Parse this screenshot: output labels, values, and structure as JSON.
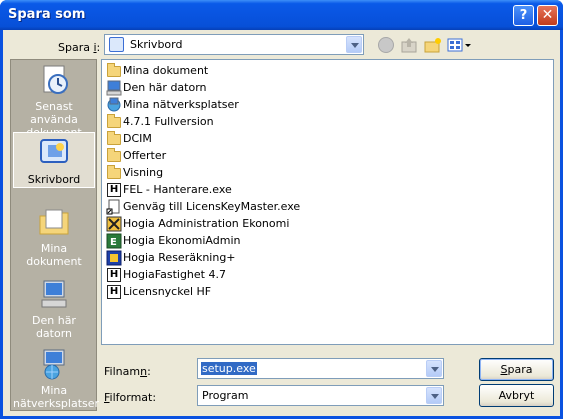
{
  "window": {
    "title": "Spara som"
  },
  "location": {
    "label_prefix": "Spara ",
    "label_key": "i",
    "label_suffix": ":",
    "value": "Skrivbord"
  },
  "places": [
    {
      "label": "Senast använda dokument",
      "icon": "recent-documents-icon"
    },
    {
      "label": "Skrivbord",
      "icon": "desktop-icon"
    },
    {
      "label": "Mina dokument",
      "icon": "my-documents-icon"
    },
    {
      "label": "Den här datorn",
      "icon": "my-computer-icon"
    },
    {
      "label": "Mina nätverksplatser",
      "icon": "network-places-icon"
    }
  ],
  "files": [
    {
      "name": "Mina dokument",
      "icon": "folder-documents-icon"
    },
    {
      "name": "Den här datorn",
      "icon": "computer-icon"
    },
    {
      "name": "Mina nätverksplatser",
      "icon": "network-icon"
    },
    {
      "name": "4.7.1 Fullversion",
      "icon": "folder-icon"
    },
    {
      "name": "DCIM",
      "icon": "folder-icon"
    },
    {
      "name": "Offerter",
      "icon": "folder-icon"
    },
    {
      "name": "Visning",
      "icon": "folder-icon"
    },
    {
      "name": "FEL - Hanterare.exe",
      "icon": "hogia-exe-icon"
    },
    {
      "name": "Genväg till LicensKeyMaster.exe",
      "icon": "shortcut-icon"
    },
    {
      "name": "Hogia Administration Ekonomi",
      "icon": "hogia-admin-icon"
    },
    {
      "name": "Hogia EkonomiAdmin",
      "icon": "hogia-ekonomi-icon"
    },
    {
      "name": "Hogia Reseräkning+",
      "icon": "hogia-rese-icon"
    },
    {
      "name": "HogiaFastighet 4.7",
      "icon": "hogia-exe-icon"
    },
    {
      "name": "Licensnyckel HF",
      "icon": "hogia-exe-icon"
    }
  ],
  "filename": {
    "label_key": "n",
    "label_prefix": "Filnam",
    "label_suffix": ":",
    "value": "setup.exe"
  },
  "filetype": {
    "label_key": "F",
    "label_rest": "ilformat:",
    "value": "Program"
  },
  "buttons": {
    "save_key": "S",
    "save_rest": "para",
    "cancel": "Avbryt"
  }
}
